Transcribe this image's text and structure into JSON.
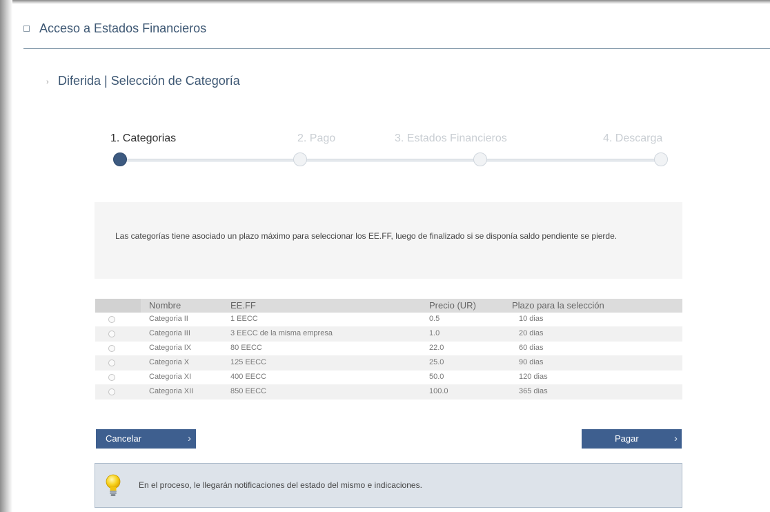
{
  "section": {
    "title": "Acceso a Estados Financieros"
  },
  "subsection": {
    "bullet": "›",
    "title": "Diferida | Selección de Categoría"
  },
  "steps": [
    {
      "label": "1. Categorias",
      "active": true
    },
    {
      "label": "2. Pago",
      "active": false
    },
    {
      "label": "3. Estados Financieros",
      "active": false
    },
    {
      "label": "4. Descarga",
      "active": false
    }
  ],
  "info": {
    "text": "Las categorías tiene asociado un plazo máximo para seleccionar los EE.FF, luego de finalizado si se disponía saldo pendiente se pierde."
  },
  "table": {
    "headers": [
      "Nombre",
      "EE.FF",
      "Precio (UR)",
      "Plazo para la selección"
    ],
    "rows": [
      [
        "Categoria II",
        "1 EECC",
        "0.5",
        "10 dias"
      ],
      [
        "Categoria III",
        "3 EECC de la misma empresa",
        "1.0",
        "20 dias"
      ],
      [
        "Categoria IX",
        "80 EECC",
        "22.0",
        "60 dias"
      ],
      [
        "Categoria X",
        "125 EECC",
        "25.0",
        "90 dias"
      ],
      [
        "Categoria XI",
        "400 EECC",
        "50.0",
        "120 dias"
      ],
      [
        "Categoria XII",
        "850 EECC",
        "100.0",
        "365 dias"
      ]
    ]
  },
  "buttons": {
    "cancel_label": "Cancelar",
    "pay_label": "Pagar",
    "chevron": "›"
  },
  "tip": {
    "icon": "lightbulb-icon",
    "text": "En el proceso, le llegarán notificaciones del estado del mismo e indicaciones."
  },
  "colors": {
    "accent": "#3e5f8f",
    "title": "#3d5773",
    "tip_bg": "#dde3ea"
  }
}
